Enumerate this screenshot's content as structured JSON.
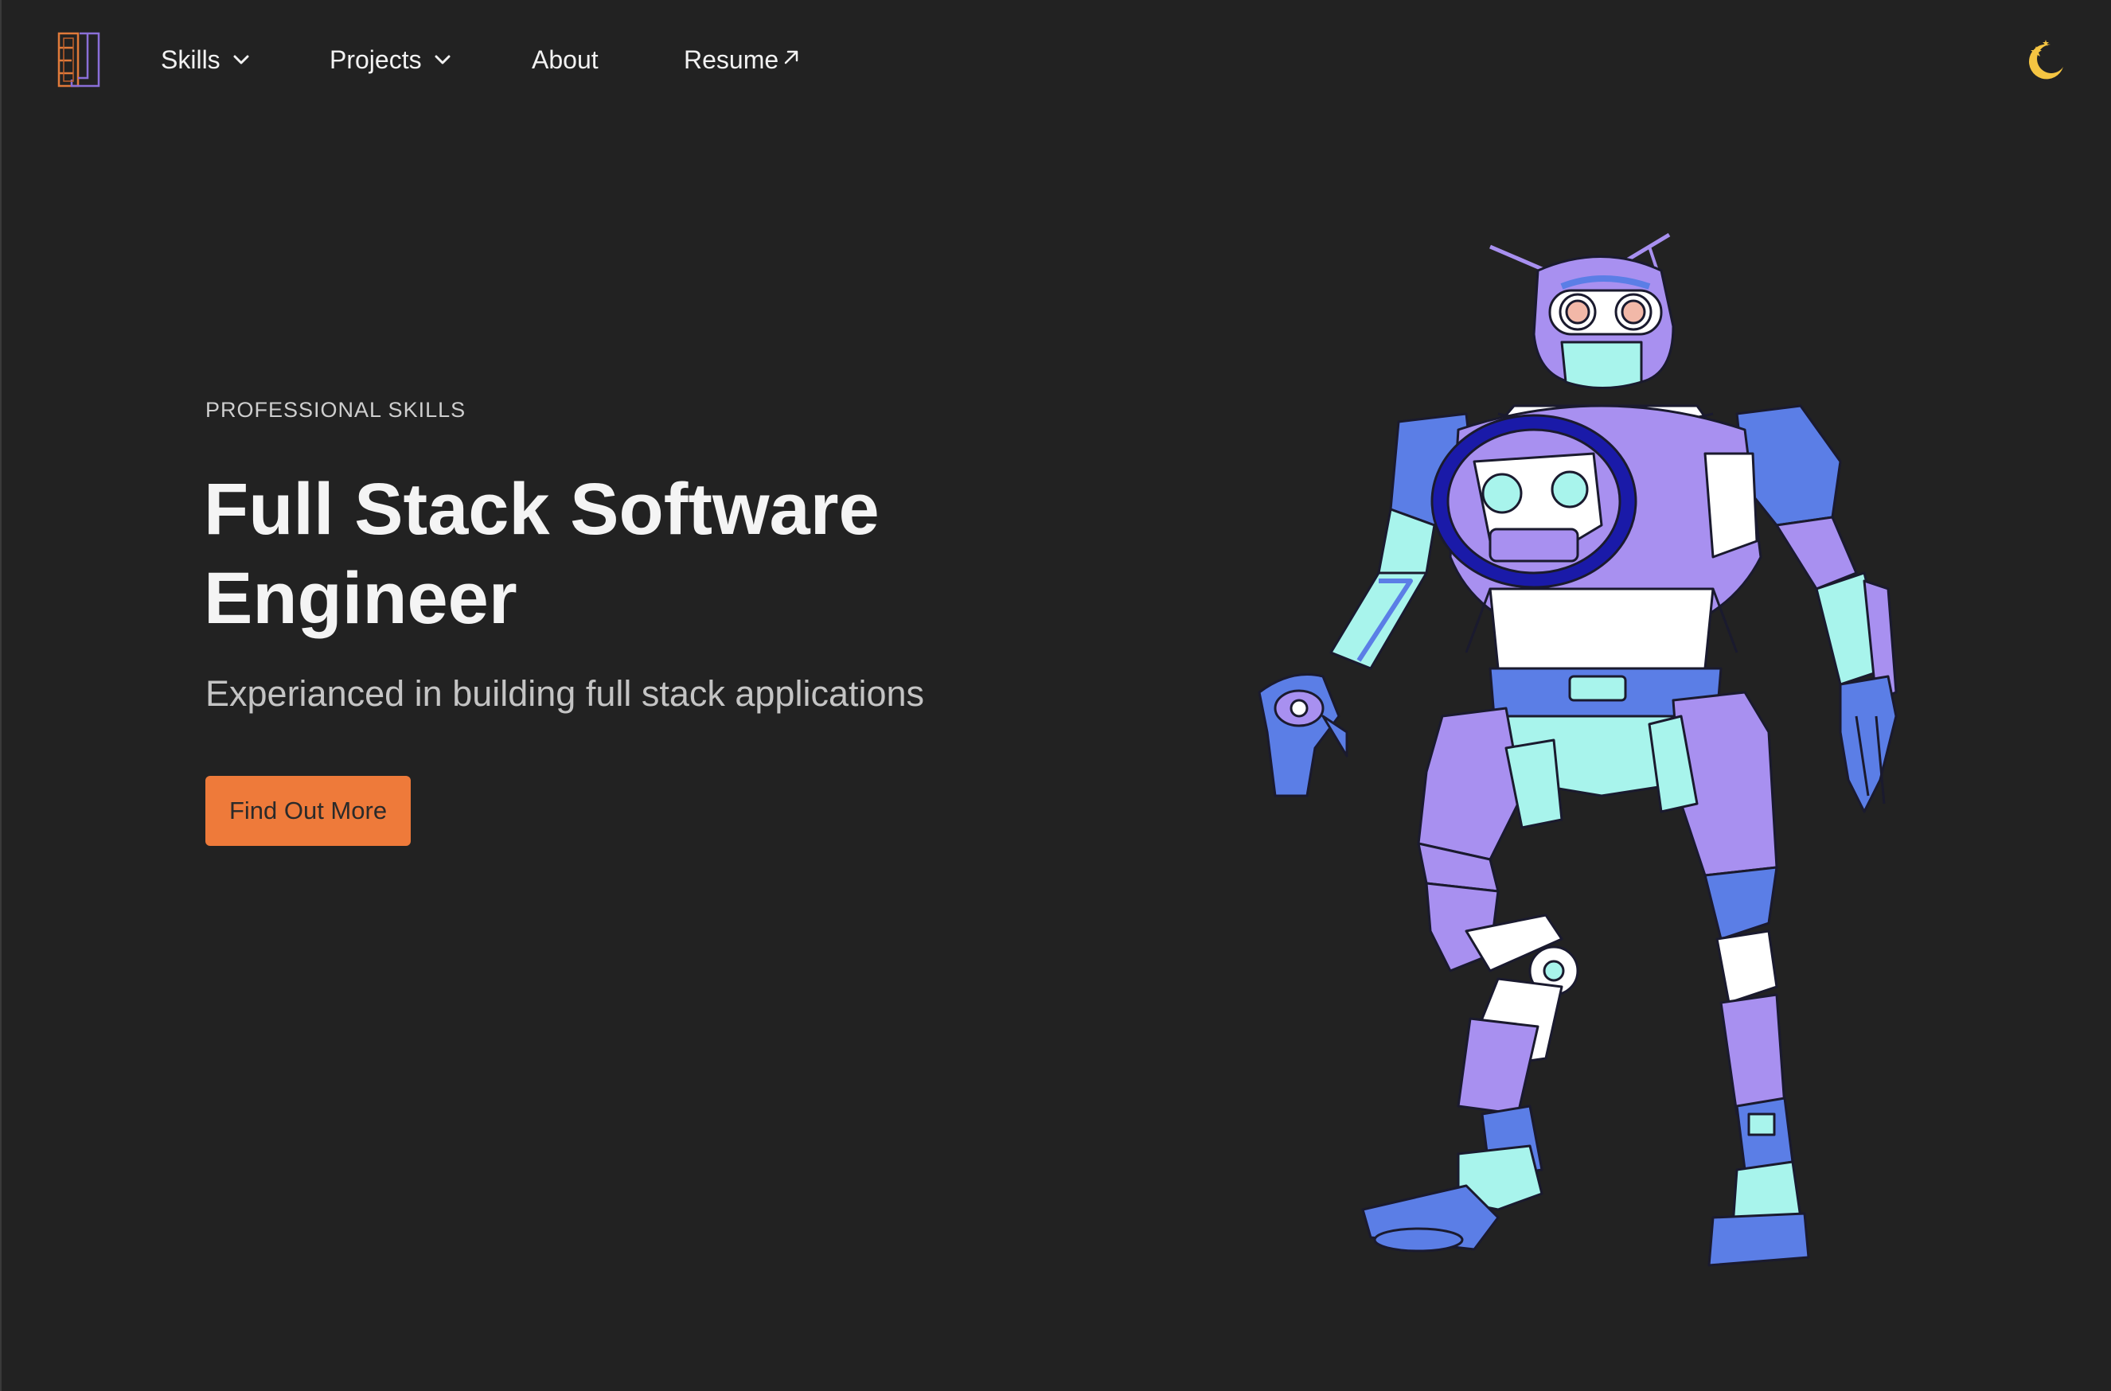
{
  "nav": {
    "logo_icon": "initials-logo-icon",
    "items": [
      {
        "label": "Skills",
        "icon": "chevron-down-icon"
      },
      {
        "label": "Projects",
        "icon": "chevron-down-icon"
      },
      {
        "label": "About"
      },
      {
        "label": "Resume",
        "icon": "external-link-arrow-icon"
      }
    ],
    "theme_toggle_icon": "moon-stars-icon"
  },
  "hero": {
    "eyebrow": "PROFESSIONAL SKILLS",
    "title": "Full Stack Software Engineer",
    "subtitle": "Experianced in building full stack applications",
    "cta_label": "Find Out More",
    "illustration": "robot-illustration"
  },
  "colors": {
    "background": "#222222",
    "accent": "#ee7a3a",
    "moon": "#f5c542",
    "robot_purple": "#a890f0",
    "robot_blue": "#5b7ee6",
    "robot_mint": "#a8f4ec",
    "robot_navy": "#1a1aa8"
  }
}
